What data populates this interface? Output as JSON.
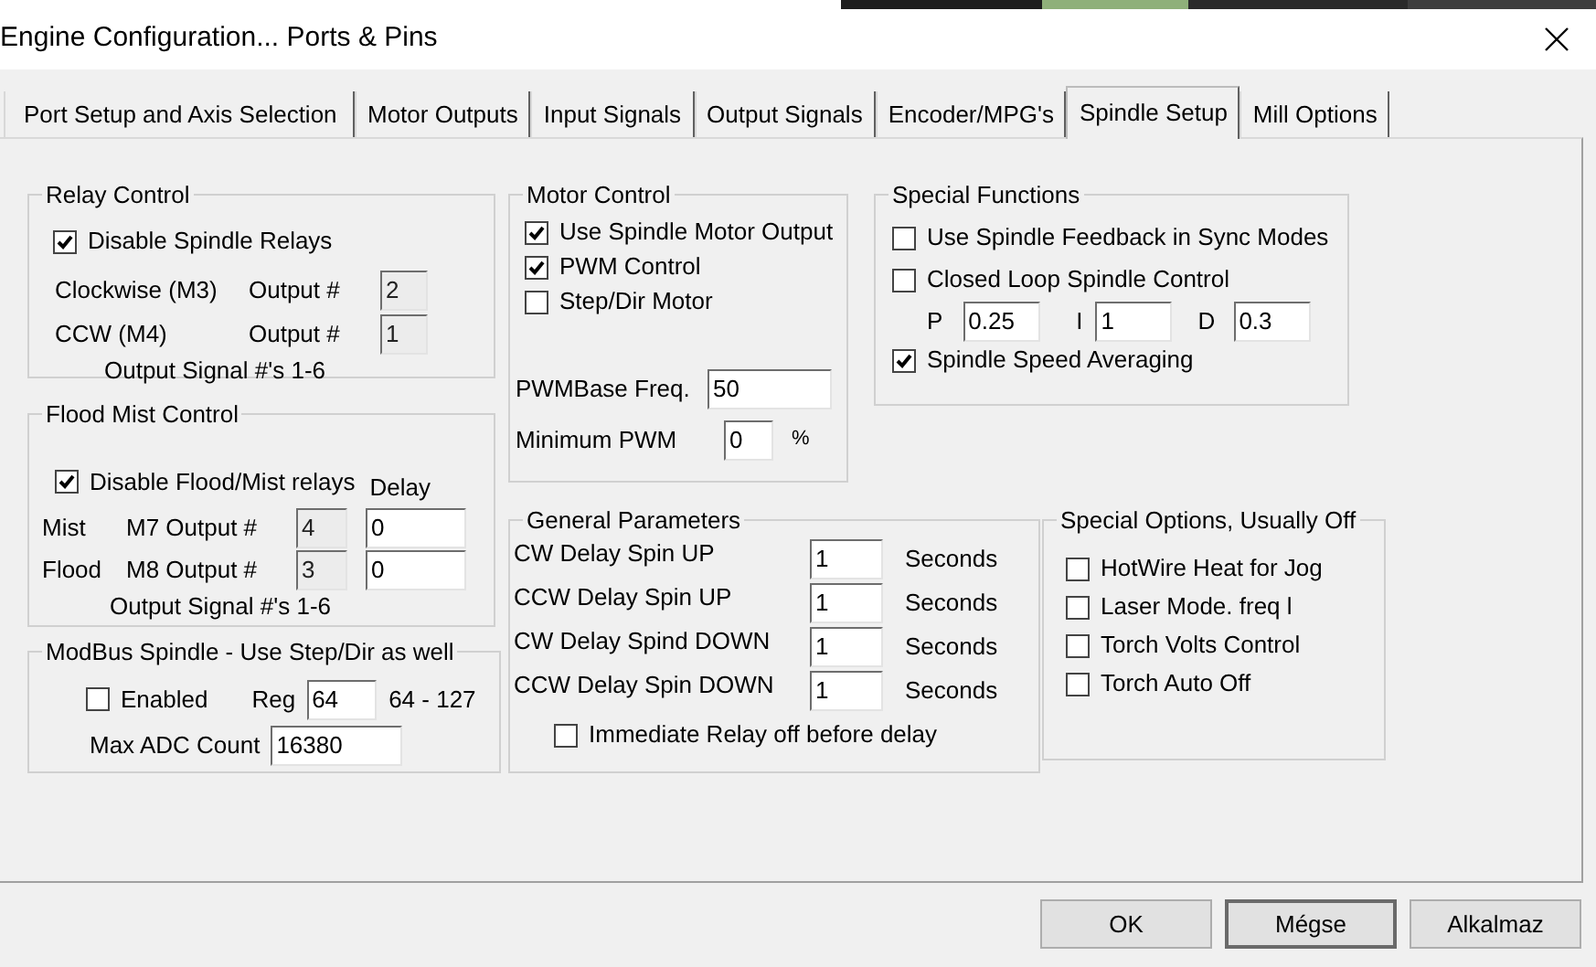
{
  "window": {
    "title": "Engine Configuration... Ports & Pins"
  },
  "tabs": [
    {
      "label": "Port Setup and Axis Selection",
      "selected": false
    },
    {
      "label": "Motor Outputs",
      "selected": false
    },
    {
      "label": "Input Signals",
      "selected": false
    },
    {
      "label": "Output Signals",
      "selected": false
    },
    {
      "label": "Encoder/MPG's",
      "selected": false
    },
    {
      "label": "Spindle Setup",
      "selected": true
    },
    {
      "label": "Mill Options",
      "selected": false
    }
  ],
  "relay_control": {
    "title": "Relay Control",
    "disable": {
      "label": "Disable Spindle Relays",
      "checked": true
    },
    "outputs": [
      {
        "label": "Clockwise (M3)",
        "output_label": "Output #",
        "value": "2",
        "disabled": true
      },
      {
        "label": "CCW (M4)",
        "output_label": "Output #",
        "value": "1",
        "disabled": true
      }
    ],
    "note": "Output Signal #'s 1-6"
  },
  "flood_mist_control": {
    "title": "Flood Mist Control",
    "disable": {
      "label": "Disable Flood/Mist relays",
      "checked": true
    },
    "delay_label": "Delay",
    "outputs": [
      {
        "label": "Mist",
        "output_label": "M7 Output #",
        "value": "4",
        "disabled": true,
        "delay": "0"
      },
      {
        "label": "Flood",
        "output_label": "M8 Output #",
        "value": "3",
        "disabled": true,
        "delay": "0"
      }
    ],
    "note": "Output Signal #'s 1-6"
  },
  "modbus_spindle": {
    "title": "ModBus Spindle - Use Step/Dir as well",
    "enabled": {
      "label": "Enabled",
      "checked": false
    },
    "reg_label": "Reg",
    "reg": "64",
    "range": "64 - 127",
    "max_adc_label": "Max ADC Count",
    "max_adc": "16380"
  },
  "motor_control": {
    "title": "Motor Control",
    "options": [
      {
        "label": "Use Spindle Motor Output",
        "checked": true
      },
      {
        "label": "PWM Control",
        "checked": true
      },
      {
        "label": "Step/Dir Motor",
        "checked": false
      }
    ],
    "pwm_base_label": "PWMBase Freq.",
    "pwm_base": "50",
    "min_pwm_label": "Minimum PWM",
    "min_pwm": "0",
    "min_pwm_unit": "%"
  },
  "special_functions": {
    "title": "Special Functions",
    "options": [
      {
        "label": "Use Spindle Feedback in Sync Modes",
        "checked": false
      },
      {
        "label": "Closed Loop Spindle Control",
        "checked": false
      }
    ],
    "pid": [
      {
        "label": "P",
        "value": "0.25"
      },
      {
        "label": "I",
        "value": "1"
      },
      {
        "label": "D",
        "value": "0.3"
      }
    ],
    "averaging": {
      "label": "Spindle Speed Averaging",
      "checked": true
    }
  },
  "general_parameters": {
    "title": "General Parameters",
    "delays": [
      {
        "label": "CW Delay Spin UP",
        "value": "1",
        "unit": "Seconds"
      },
      {
        "label": "CCW Delay Spin UP",
        "value": "1",
        "unit": "Seconds"
      },
      {
        "label": "CW Delay Spind DOWN",
        "value": "1",
        "unit": "Seconds"
      },
      {
        "label": "CCW Delay Spin DOWN",
        "value": "1",
        "unit": "Seconds"
      }
    ],
    "immediate_relay_off": {
      "label": "Immediate Relay off before delay",
      "checked": false
    }
  },
  "special_options": {
    "title": "Special Options, Usually Off",
    "options": [
      {
        "label": "HotWire Heat for Jog",
        "checked": false
      },
      {
        "label": "Laser Mode. freq l",
        "checked": false
      },
      {
        "label": "Torch Volts Control",
        "checked": false
      },
      {
        "label": "Torch Auto Off",
        "checked": false
      }
    ]
  },
  "buttons": [
    {
      "label": "OK",
      "focused": false
    },
    {
      "label": "Mégse",
      "focused": true
    },
    {
      "label": "Alkalmaz",
      "focused": false
    }
  ]
}
